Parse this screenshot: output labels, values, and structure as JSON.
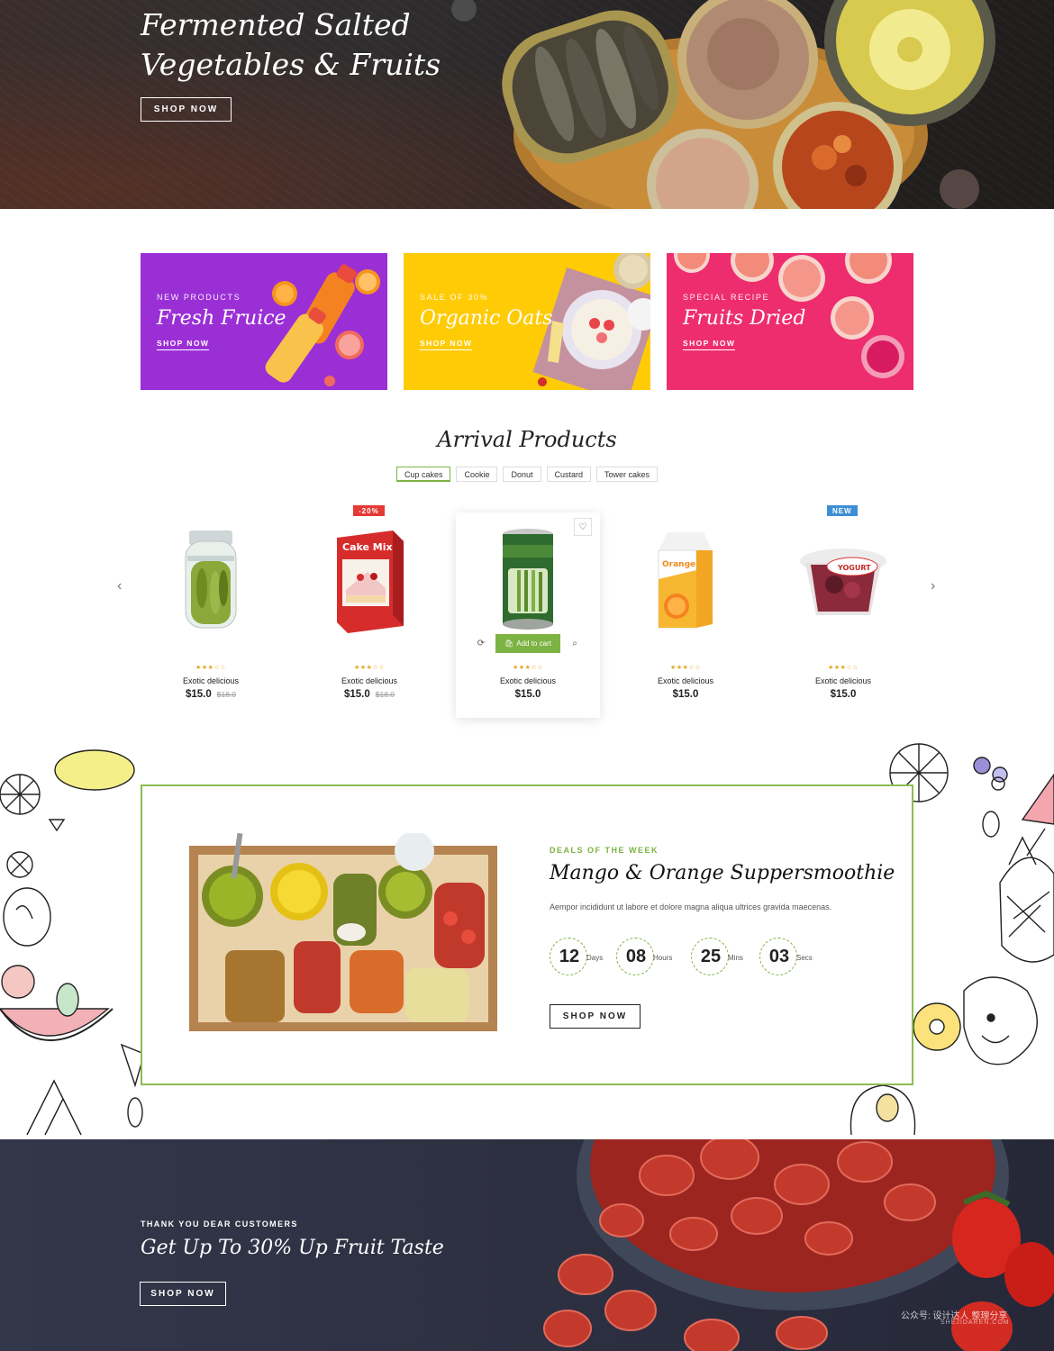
{
  "hero": {
    "title_line1": "Fermented Salted",
    "title_line2": "Vegetables & Fruits",
    "button": "SHOP NOW"
  },
  "banners": [
    {
      "pre": "NEW PRODUCTS",
      "title": "Fresh Fruice",
      "link": "SHOP NOW",
      "bg": "#9b2fd6"
    },
    {
      "pre": "SALE OF 30%",
      "title": "Organic Oats",
      "link": "SHOP NOW",
      "bg": "#ffcb05"
    },
    {
      "pre": "SPECIAL RECIPE",
      "title": "Fruits Dried",
      "link": "SHOP NOW",
      "bg": "#ee2d6e"
    }
  ],
  "arrivals": {
    "title": "Arrival Products",
    "tabs": [
      "Cup cakes",
      "Cookie",
      "Donut",
      "Custard",
      "Tower cakes"
    ],
    "active_tab": "Cup cakes",
    "products": [
      {
        "name": "Exotic delicious",
        "price": "$15.0",
        "old_price": "$18.0",
        "stars": "★★★☆☆",
        "badge": ""
      },
      {
        "name": "Exotic delicious",
        "price": "$15.0",
        "old_price": "$18.0",
        "stars": "★★★☆☆",
        "badge": "-20%"
      },
      {
        "name": "Exotic delicious",
        "price": "$15.0",
        "old_price": "",
        "stars": "★★★☆☆",
        "badge": "",
        "add_to_cart": "Add to cart"
      },
      {
        "name": "Exotic delicious",
        "price": "$15.0",
        "old_price": "",
        "stars": "★★★☆☆",
        "badge": ""
      },
      {
        "name": "Exotic delicious",
        "price": "$15.0",
        "old_price": "",
        "stars": "★★★☆☆",
        "badge": "NEW"
      }
    ],
    "prev_arrow": "‹",
    "next_arrow": "›"
  },
  "deals": {
    "pre": "DEALS OF THE WEEK",
    "title": "Mango & Orange Suppersmoothie",
    "description": "Aempor incididunt ut labore et dolore magna aliqua ultrices gravida maecenas.",
    "countdown": [
      {
        "value": "12",
        "unit": "Days"
      },
      {
        "value": "08",
        "unit": "Hours"
      },
      {
        "value": "25",
        "unit": "Mins"
      },
      {
        "value": "03",
        "unit": "Secs"
      }
    ],
    "button": "SHOP NOW"
  },
  "promo": {
    "pre": "THANK YOU DEAR CUSTOMERS",
    "title": "Get Up To 30% Up Fruit Taste",
    "button": "SHOP NOW"
  },
  "watermark": {
    "line1": "公众号: 设计达人 整理分享",
    "line2": "SHEJIDAREN.COM"
  },
  "colors": {
    "accent_green": "#7cb342",
    "badge_red": "#e53935",
    "badge_blue": "#3d8fd4"
  }
}
